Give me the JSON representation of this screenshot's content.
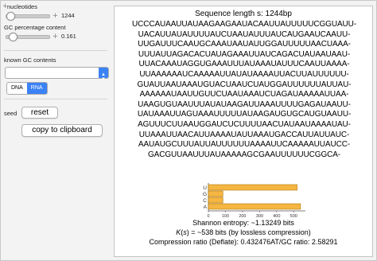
{
  "controls": {
    "nucleotides_label": "nucleotides",
    "nucleotides_value": "1244",
    "nucleotides_fraction": 0.12,
    "gc_label": "GC percentage content",
    "gc_value": "0.161",
    "gc_fraction": 0.16,
    "known_label": "known GC contents",
    "known_selected": "",
    "dna_label": "DNA",
    "rna_label": "RNA",
    "seed_label": "seed",
    "reset_label": "reset",
    "copy_label": "copy to clipboard"
  },
  "output": {
    "title": "Sequence length s: 1244bp",
    "sequence_lines": [
      "UCCCAUAAUUAUAAGAAGAAUACAAUUAUUUUUCGGUAUU-",
      "UACAUUAUAUUUUAUCUAAUAUUUAUCAUGAAUCAAUU-",
      "UUGAUUUCAAUGCAAAUAAUAUUGGAUUUUUAACUAAA-",
      "UUUAUUAGACACUAUAGAAAUUAUCAGACUAUAAUAAU-",
      "UUACAAAUAGGUGAAAUUUAUAAAUAUUUCAAUUAAAA-",
      "UUAAAAAAUCAAAAAUUAUAUAAAAUUACUUAUUUUUU-",
      "GUAUUAAUAAAUGUACUAAUCUAUGGAUUUUUUAUUAU-",
      "AAAAAAUAAUUGUUCUAAUAAAUCUAGAUAAAAAUUAA-",
      "UAAGUGUAAUUUAUAUAAGAUUAAAUUUUGAGAUAAUU-",
      "UAUAAAUUAGUAAAUUUUUAUAAGAUGUGCAUGUAAUU-",
      "AGUUUCUUAAUGGAUCUCUUUUAACUAUAAUAAAAUAU-",
      "UUAAAUUAACAUUAAAAUAUUAAAUGACCAUUAUUAUC-",
      "AAUAUGCUUUAUUAUUUUUUAAAAUUCAAAAAUUAUCC-",
      "GACGUUAAUUUAUAAAAAGCGAAUUUUUUCGGCA-"
    ],
    "entropy_text": "Shannon entropy: ~1.13249 bits",
    "bits_text_k": "K",
    "bits_text_s": "s",
    "bits_text_rest": ") = ~538 bits (by lossless compression)",
    "compression_text": "Compression ratio (Deflate): 0.432476AT/GC ratio: 2.58291"
  },
  "chart_data": {
    "type": "bar",
    "orientation": "horizontal",
    "categories": [
      "U",
      "G",
      "C",
      "A"
    ],
    "values": [
      520,
      85,
      85,
      540
    ],
    "xlim": [
      0,
      550
    ],
    "xticks": [
      0,
      100,
      200,
      300,
      400,
      500
    ],
    "bar_color": "#f5b642"
  }
}
